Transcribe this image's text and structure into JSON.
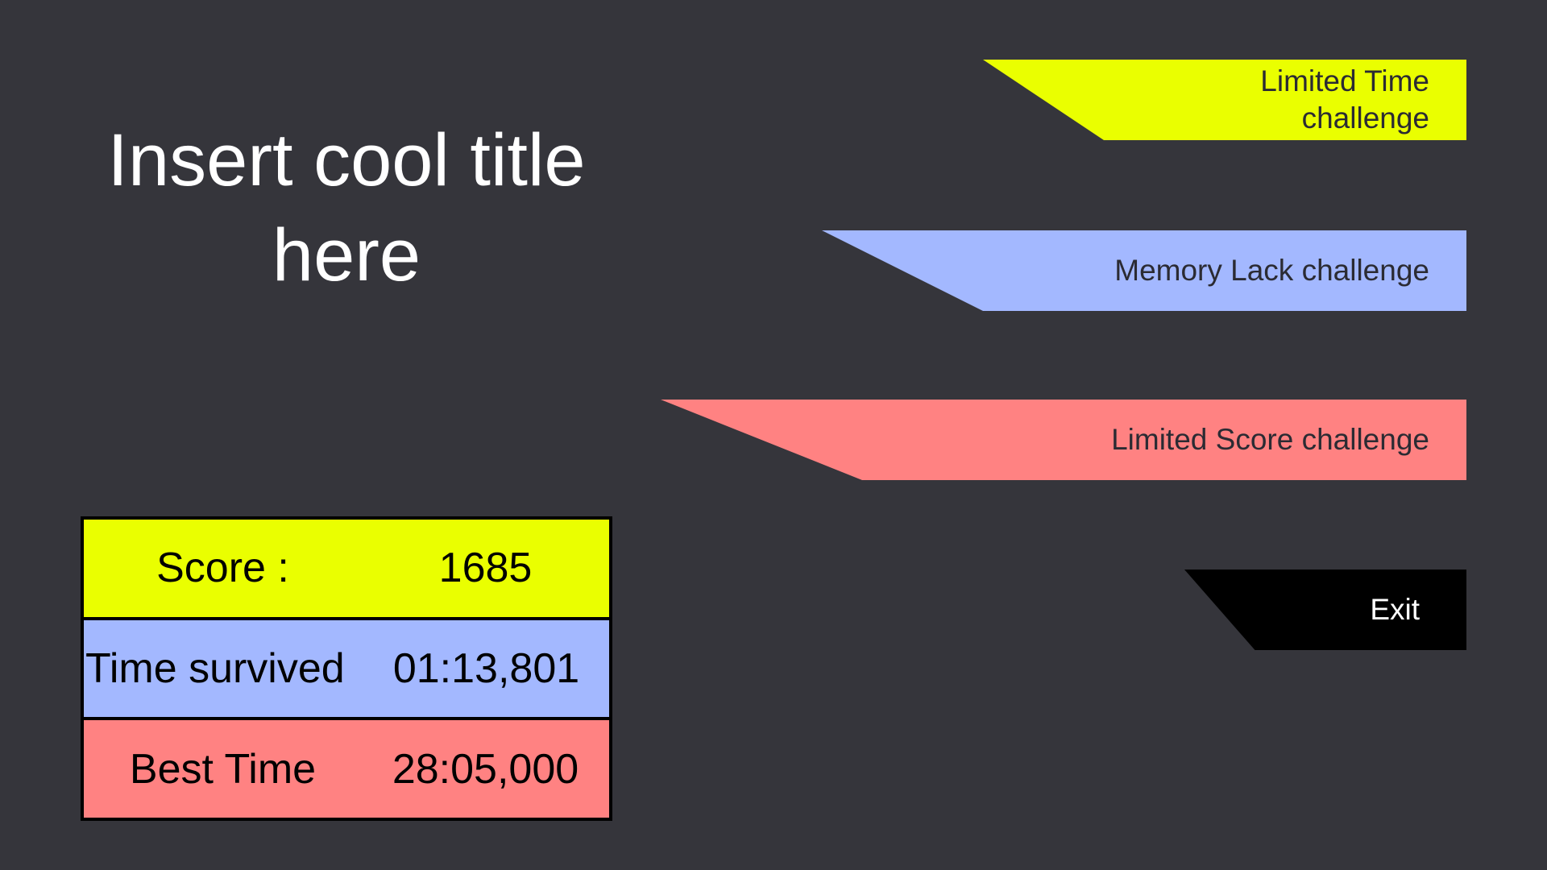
{
  "title": "Insert cool title\nhere",
  "menu": {
    "limited_time": "Limited Time\nchallenge",
    "memory_lack": "Memory Lack challenge",
    "limited_score": "Limited Score challenge",
    "exit": "Exit"
  },
  "stats": {
    "score_label": "Score :",
    "score_value": "1685",
    "time_label": "Time survived",
    "time_value": "01:13,801",
    "best_label": "Best Time",
    "best_value": "28:05,000"
  },
  "colors": {
    "background": "#35353b",
    "yellow": "#eaff00",
    "blue": "#a3b8ff",
    "red": "#ff8282",
    "black": "#000000"
  }
}
